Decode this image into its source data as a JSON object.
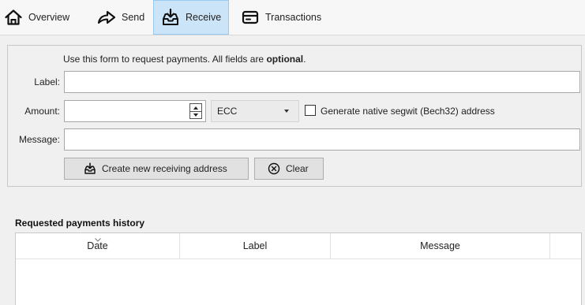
{
  "toolbar": {
    "tabs": [
      {
        "id": "overview",
        "label": "Overview",
        "icon": "home-icon",
        "active": false
      },
      {
        "id": "send",
        "label": "Send",
        "icon": "send-arrow-icon",
        "active": false
      },
      {
        "id": "receive",
        "label": "Receive",
        "icon": "inbox-receive-icon",
        "active": true
      },
      {
        "id": "transactions",
        "label": "Transactions",
        "icon": "card-list-icon",
        "active": false
      }
    ]
  },
  "receive_form": {
    "hint_prefix": "Use this form to request payments. All fields are ",
    "hint_bold": "optional",
    "hint_suffix": ".",
    "label_field": {
      "label": "Label:",
      "value": "",
      "placeholder": ""
    },
    "amount_field": {
      "label": "Amount:",
      "value": ""
    },
    "unit": {
      "selected": "ECC"
    },
    "segwit": {
      "label": "Generate native segwit (Bech32) address",
      "checked": false
    },
    "message_field": {
      "label": "Message:",
      "value": "",
      "placeholder": ""
    },
    "buttons": {
      "create": "Create new receiving address",
      "clear": "Clear"
    }
  },
  "history": {
    "title": "Requested payments history",
    "columns": [
      "Date",
      "Label",
      "Message",
      ""
    ],
    "rows": []
  },
  "colors": {
    "active_tab_bg": "#cce4f7",
    "active_tab_border": "#99c9ef",
    "window_bg": "#f0f0f0"
  }
}
